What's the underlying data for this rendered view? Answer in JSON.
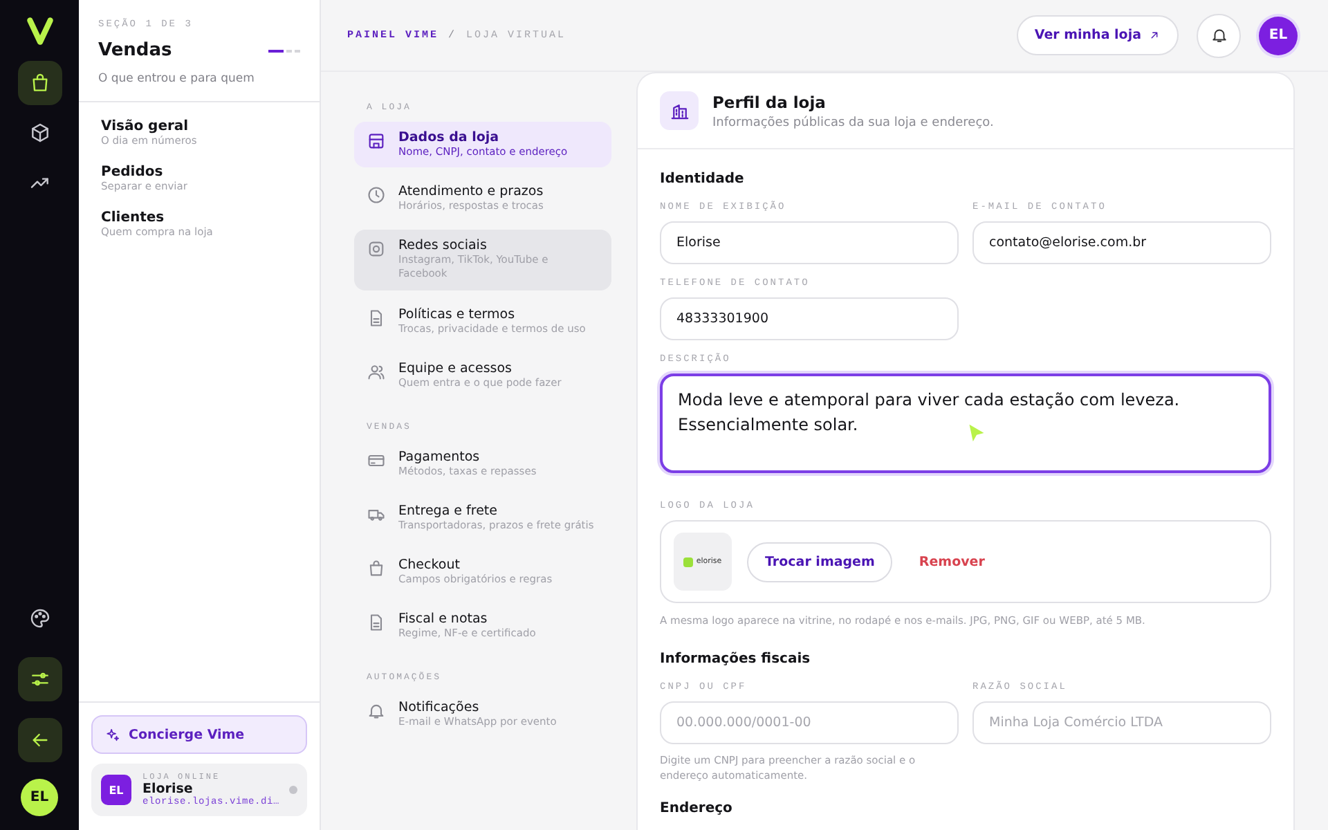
{
  "rail": {
    "top": [
      {
        "kind": "bag",
        "selected": true
      },
      {
        "kind": "box",
        "selected": false
      },
      {
        "kind": "trend",
        "selected": false
      }
    ],
    "bottom": [
      {
        "kind": "palette",
        "selected": false
      },
      {
        "kind": "sliders",
        "selected": true
      },
      {
        "kind": "back",
        "selected": true
      }
    ],
    "avatar": "EL"
  },
  "section_panel": {
    "eyebrow": "SEÇÃO 1 DE 3",
    "title": "Vendas",
    "subtitle": "O que entrou e para quem",
    "steps": [
      {
        "selected": true
      },
      {
        "selected": false
      },
      {
        "selected": false
      }
    ],
    "items": [
      {
        "label": "Visão geral",
        "hint": "O dia em números"
      },
      {
        "label": "Pedidos",
        "hint": "Separar e enviar"
      },
      {
        "label": "Clientes",
        "hint": "Quem compra na loja"
      }
    ],
    "concierge": "Concierge Vime",
    "store": {
      "initials": "EL",
      "eyebrow": "LOJA ONLINE",
      "name": "Elorise",
      "url": "elorise.lojas.vime.di…"
    }
  },
  "topbar": {
    "breadcrumb": [
      "PAINEL VIME",
      "LOJA VIRTUAL"
    ],
    "separator": "/",
    "view_store": "Ver minha loja",
    "avatar": "EL"
  },
  "settings_nav": [
    {
      "heading": "A LOJA",
      "items": [
        {
          "kind": "store",
          "label": "Dados da loja",
          "hint": "Nome, CNPJ, contato e endereço",
          "selected": true,
          "hovered": false
        },
        {
          "kind": "clock",
          "label": "Atendimento e prazos",
          "hint": "Horários, respostas e trocas",
          "selected": false,
          "hovered": false
        },
        {
          "kind": "camera",
          "label": "Redes sociais",
          "hint": "Instagram, TikTok, YouTube e Facebook",
          "selected": false,
          "hovered": true
        },
        {
          "kind": "doc",
          "label": "Políticas e termos",
          "hint": "Trocas, privacidade e termos de uso",
          "selected": false,
          "hovered": false
        },
        {
          "kind": "team",
          "label": "Equipe e acessos",
          "hint": "Quem entra e o que pode fazer",
          "selected": false,
          "hovered": false
        }
      ]
    },
    {
      "heading": "VENDAS",
      "items": [
        {
          "kind": "card",
          "label": "Pagamentos",
          "hint": "Métodos, taxas e repasses",
          "selected": false,
          "hovered": false
        },
        {
          "kind": "truck",
          "label": "Entrega e frete",
          "hint": "Transportadoras, prazos e frete grátis",
          "selected": false,
          "hovered": false
        },
        {
          "kind": "bag",
          "label": "Checkout",
          "hint": "Campos obrigatórios e regras",
          "selected": false,
          "hovered": false
        },
        {
          "kind": "doc",
          "label": "Fiscal e notas",
          "hint": "Regime, NF-e e certificado",
          "selected": false,
          "hovered": false
        }
      ]
    },
    {
      "heading": "AUTOMAÇÕES",
      "items": [
        {
          "kind": "bell",
          "label": "Notificações",
          "hint": "E-mail e WhatsApp por evento",
          "selected": false,
          "hovered": false
        }
      ]
    }
  ],
  "profile": {
    "title": "Perfil da loja",
    "subtitle": "Informações públicas da sua loja e endereço.",
    "identity_title": "Identidade",
    "fields": [
      {
        "label": "NOME DE EXIBIÇÃO",
        "value": "Elorise"
      },
      {
        "label": "E-MAIL DE CONTATO",
        "value": "contato@elorise.com.br"
      },
      {
        "label": "TELEFONE DE CONTATO",
        "value": "48333301900"
      }
    ],
    "description": {
      "label": "DESCRIÇÃO",
      "value": "Moda leve e atemporal para viver cada estação com leveza. Essencialmente solar.",
      "focused": true
    },
    "logo": {
      "label": "LOGO DA LOJA",
      "logo_text": "elorise",
      "change": "Trocar imagem",
      "remove": "Remover",
      "hint": "A mesma logo aparece na vitrine, no rodapé e nos e-mails. JPG, PNG, GIF ou WEBP, até 5 MB."
    },
    "fiscal_title": "Informações fiscais",
    "fiscal_fields": [
      {
        "label": "CNPJ OU CPF",
        "placeholder": "00.000.000/0001-00",
        "hint": "Digite um CNPJ para preencher a razão social e o endereço automaticamente."
      },
      {
        "label": "RAZÃO SOCIAL",
        "placeholder": "Minha Loja Comércio LTDA"
      }
    ],
    "address_title": "Endereço"
  }
}
